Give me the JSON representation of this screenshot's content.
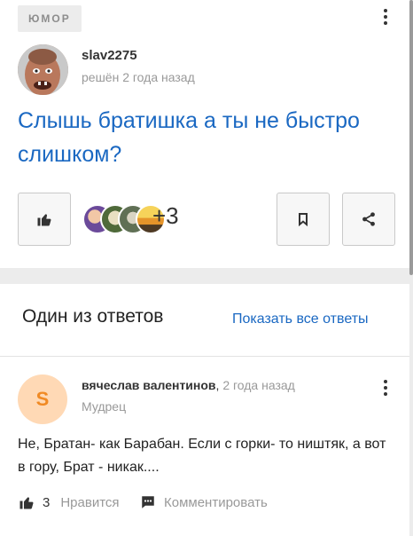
{
  "question_card": {
    "category": "ЮМОР",
    "author": "slav2275",
    "status_time": "решён 2 года назад",
    "question_title": "Слышь братишка а ты не быстро слишком?",
    "likes_extra": "+3"
  },
  "answers_card": {
    "heading": "Один из ответов",
    "show_all": "Показать все ответы",
    "answer": {
      "avatar_letter": "S",
      "author": "вячеслав валентинов",
      "separator": ",",
      "time": "2 года назад",
      "rank": "Мудрец",
      "text": "Не, Братан- как Барабан. Если с горки- то ништяк, а вот в гору, Брат - никак....",
      "likes_count": "3",
      "like_label": "Нравится",
      "comment_label": "Комментировать"
    }
  },
  "colors": {
    "link_blue": "#1a68c2",
    "muted": "#999999",
    "avatar_bg": "#ffd9b5",
    "avatar_letter": "#f08a24"
  }
}
